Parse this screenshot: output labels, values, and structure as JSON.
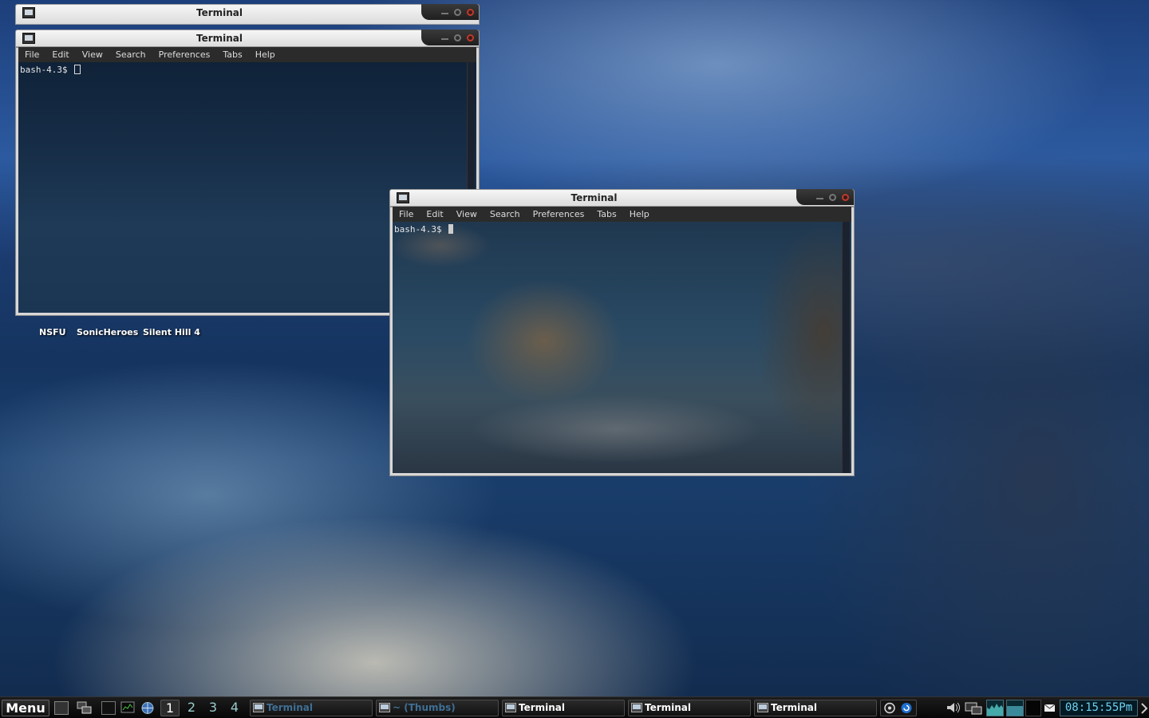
{
  "desktop": {
    "icons": [
      {
        "label": "NSFU"
      },
      {
        "label": "SonicHeroes"
      },
      {
        "label": "Silent Hill 4"
      }
    ]
  },
  "windows": [
    {
      "title": "Terminal",
      "state": "background-top"
    },
    {
      "title": "Terminal",
      "menu": [
        "File",
        "Edit",
        "View",
        "Search",
        "Preferences",
        "Tabs",
        "Help"
      ],
      "prompt": "bash-4.3$ "
    },
    {
      "title": "Terminal",
      "menu": [
        "File",
        "Edit",
        "View",
        "Search",
        "Preferences",
        "Tabs",
        "Help"
      ],
      "prompt": "bash-4.3$ "
    }
  ],
  "taskbar": {
    "menu_label": "Menu",
    "workspaces": [
      "1",
      "2",
      "3",
      "4"
    ],
    "active_workspace": "1",
    "tasks": [
      {
        "label": "Terminal",
        "dim": true
      },
      {
        "label": "~ (Thumbs)",
        "dim": true
      },
      {
        "label": "Terminal",
        "dim": false
      },
      {
        "label": "Terminal",
        "dim": false
      },
      {
        "label": "Terminal",
        "dim": false
      }
    ],
    "clock": "08:15:55Pm",
    "icons": [
      "terminal-icon",
      "monitor-icon",
      "browser-icon",
      "steam-icon",
      "update-icon",
      "volume-icon",
      "network-icon",
      "cpu-graph-icon",
      "mail-icon",
      "arrow-icon"
    ]
  },
  "colors": {
    "clock_text": "#6fd0f0",
    "close_button": "#c0392b"
  }
}
